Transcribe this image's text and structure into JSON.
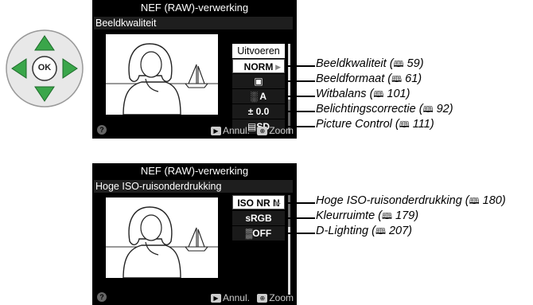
{
  "screen1": {
    "title": "NEF (RAW)-verwerking",
    "heading": "Beeldkwaliteit",
    "menu": [
      "Uitvoeren",
      "NORM",
      "▣",
      "░ A",
      "± 0.0",
      "▤SD"
    ],
    "footer_help": "?",
    "footer_cancel": "Annul.",
    "footer_zoom": "Zoom"
  },
  "screen2": {
    "title": "NEF (RAW)-verwerking",
    "heading": "Hoge ISO-ruisonderdrukking",
    "menu": [
      "ISO NR N",
      "sRGB",
      "▒OFF"
    ],
    "footer_help": "?",
    "footer_cancel": "Annul.",
    "footer_zoom": "Zoom"
  },
  "callouts1": [
    {
      "text": "Beeldkwaliteit",
      "ref": "59"
    },
    {
      "text": "Beeldformaat",
      "ref": "61"
    },
    {
      "text": "Witbalans",
      "ref": "101"
    },
    {
      "text": "Belichtingscorrectie",
      "ref": "92"
    },
    {
      "text": "Picture Control",
      "ref": "111"
    }
  ],
  "callouts2": [
    {
      "text": "Hoge ISO-ruisonderdrukking",
      "ref": "180"
    },
    {
      "text": "Kleurruimte",
      "ref": "179"
    },
    {
      "text": "D-Lighting",
      "ref": "207"
    }
  ],
  "selector": {
    "center": "OK"
  },
  "book_icon": "book-icon",
  "colors": {
    "accent_green": "#3aa64a",
    "screen_bg": "#000000"
  }
}
